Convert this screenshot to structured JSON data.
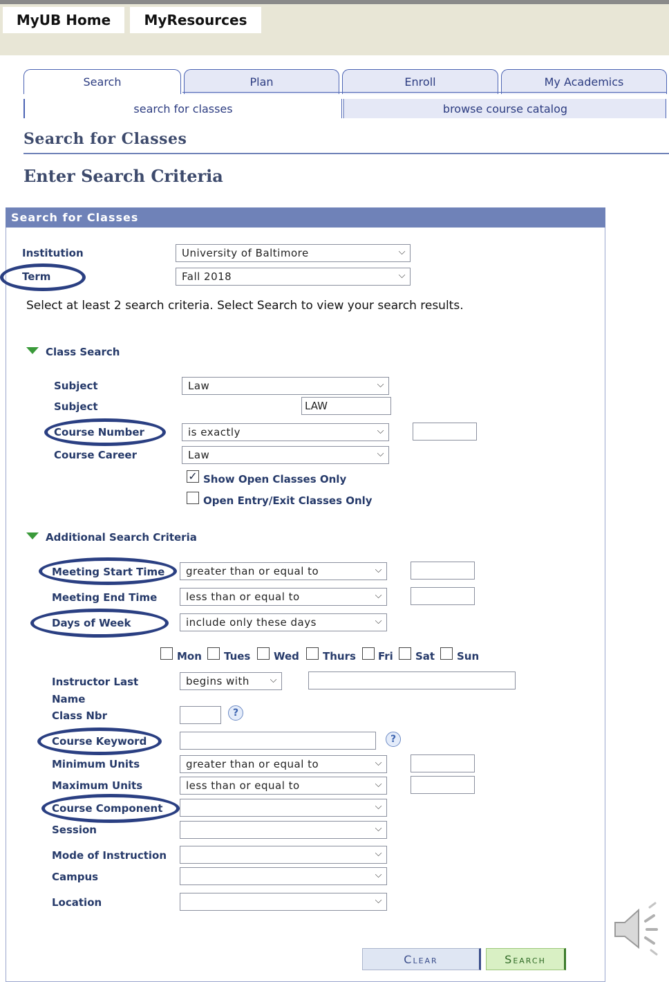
{
  "topnav": {
    "home": "MyUB Home",
    "resources": "MyResources"
  },
  "tabs": [
    "Search",
    "Plan",
    "Enroll",
    "My Academics"
  ],
  "subtabs": {
    "search": "search for classes",
    "browse": "browse course catalog"
  },
  "page": {
    "title": "Search for Classes",
    "subtitle": "Enter Search Criteria"
  },
  "panel": {
    "header": "Search for Classes",
    "institution_label": "Institution",
    "institution_value": "University of Baltimore",
    "term_label": "Term",
    "term_value": "Fall 2018",
    "instructions": "Select at least 2 search criteria. Select Search to view your search results."
  },
  "class_search": {
    "title": "Class Search",
    "subject_label": "Subject",
    "subject_value": "Law",
    "subject2_label": "Subject",
    "subject2_value": "LAW",
    "course_number_label": "Course Number",
    "course_number_op": "is exactly",
    "course_career_label": "Course Career",
    "course_career_value": "Law",
    "open_only_label": "Show Open Classes Only",
    "open_only_checked": true,
    "open_entry_label": "Open Entry/Exit Classes Only",
    "open_entry_checked": false
  },
  "additional": {
    "title": "Additional Search Criteria",
    "start_time_label": "Meeting Start Time",
    "start_time_op": "greater than or equal to",
    "end_time_label": "Meeting End Time",
    "end_time_op": "less than or equal to",
    "days_label": "Days of Week",
    "days_op": "include only these days",
    "days": [
      "Mon",
      "Tues",
      "Wed",
      "Thurs",
      "Fri",
      "Sat",
      "Sun"
    ],
    "instructor_label_1": "Instructor Last",
    "instructor_label_2": "Name",
    "instructor_op": "begins with",
    "class_nbr_label": "Class Nbr",
    "keyword_label": "Course Keyword",
    "min_units_label": "Minimum Units",
    "min_units_op": "greater than or equal to",
    "max_units_label": "Maximum Units",
    "max_units_op": "less than or equal to",
    "component_label": "Course Component",
    "session_label": "Session",
    "mode_label": "Mode of Instruction",
    "campus_label": "Campus",
    "location_label": "Location"
  },
  "buttons": {
    "clear": "Clear",
    "search": "Search"
  },
  "icons": {
    "help": "?",
    "chevron": "⌵"
  },
  "colors": {
    "panel_header": "#6f82b8",
    "annotation": "#2a3f82",
    "search_button": "#d9f0c4",
    "clear_button": "#dfe6f3"
  }
}
